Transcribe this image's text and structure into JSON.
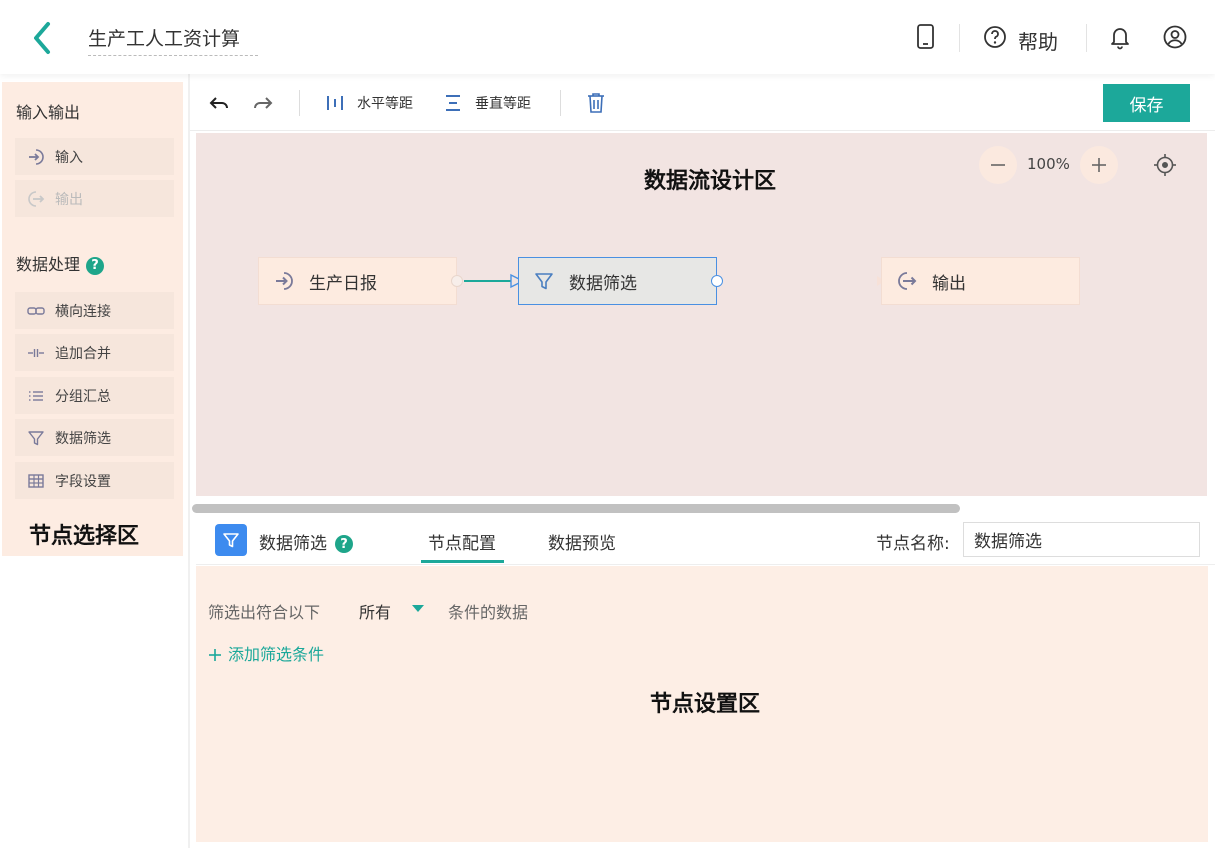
{
  "header": {
    "title": "生产工人工资计算",
    "help_label": "帮助",
    "icons": [
      "back-arrow-icon",
      "mobile-icon",
      "help-circle-icon",
      "bell-icon",
      "user-icon"
    ]
  },
  "left_panel": {
    "section_io": "输入输出",
    "io_items": [
      {
        "label": "输入",
        "icon": "input-icon",
        "disabled": false
      },
      {
        "label": "输出",
        "icon": "output-icon",
        "disabled": true
      }
    ],
    "section_processing": "数据处理",
    "help_badge": "?",
    "processing_items": [
      {
        "label": "横向连接",
        "icon": "link-icon"
      },
      {
        "label": "追加合并",
        "icon": "merge-icon"
      },
      {
        "label": "分组汇总",
        "icon": "list-icon"
      },
      {
        "label": "数据筛选",
        "icon": "filter-icon"
      },
      {
        "label": "字段设置",
        "icon": "table-icon"
      }
    ],
    "zone_label": "节点选择区"
  },
  "toolbar": {
    "horizontal_label": "水平等距",
    "vertical_label": "垂直等距",
    "save_label": "保存"
  },
  "canvas": {
    "zone_label": "数据流设计区",
    "zoom": "100%",
    "nodes": [
      {
        "label": "生产日报",
        "icon": "input-icon"
      },
      {
        "label": "数据筛选",
        "icon": "filter-icon",
        "selected": true
      },
      {
        "label": "输出",
        "icon": "output-icon"
      }
    ]
  },
  "bottom_panel": {
    "title": "数据筛选",
    "help_badge": "?",
    "tabs": [
      "节点配置",
      "数据预览"
    ],
    "active_tab": "节点配置",
    "name_label": "节点名称:",
    "name_value": "数据筛选",
    "filter_prefix": "筛选出符合以下",
    "filter_mode": "所有",
    "filter_suffix": "条件的数据",
    "add_condition": "添加筛选条件",
    "zone_label": "节点设置区"
  },
  "colors": {
    "accent": "#1ca89a",
    "selected_border": "#4a90e2",
    "panel_bg": "#fdece2",
    "canvas_bg": "#f2e4e2"
  }
}
